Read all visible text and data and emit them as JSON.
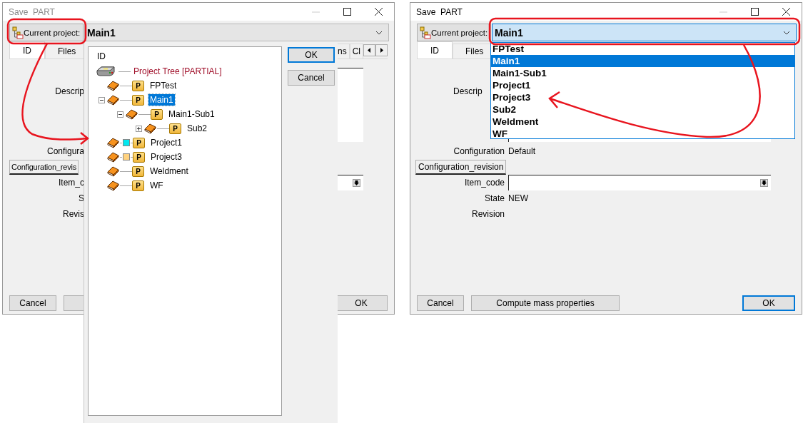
{
  "left_dialog": {
    "title": "Save  PART",
    "active": false,
    "project_label": "Current project:",
    "project": "Main1",
    "project_focused": false,
    "tabs": [
      {
        "label": "ID",
        "selected": true
      },
      {
        "label": "Files",
        "selected": false
      }
    ],
    "tabs_tail": [
      {
        "label": "ns",
        "selected": false
      },
      {
        "label": "Cl",
        "selected": false
      }
    ],
    "fields": [
      {
        "kind": "multiline",
        "label": "Descrip"
      },
      {
        "kind": "text",
        "label": "Configura"
      },
      {
        "kind": "button",
        "label": "Configuration_revis"
      },
      {
        "kind": "dropdown",
        "label": "Item_c"
      },
      {
        "kind": "text",
        "label": "S"
      },
      {
        "kind": "text",
        "label": "Revis"
      }
    ],
    "buttons": [
      {
        "kind": "cancel",
        "label": "Cancel",
        "focused": false
      },
      {
        "kind": "blank",
        "focused": false
      },
      {
        "kind": "ok",
        "label": "OK",
        "focused": false
      }
    ],
    "popup": {
      "header": "ID",
      "tree": {
        "label": "Project Tree [PARTIAL]",
        "children": [
          {
            "label": "FPTest",
            "icon_letter": "P",
            "selected": false
          },
          {
            "label": "Main1",
            "icon_letter": "P",
            "selected": true,
            "expanded": true,
            "children": [
              {
                "label": "Main1-Sub1",
                "icon_letter": "P",
                "selected": false,
                "expanded": true,
                "children": [
                  {
                    "label": "Sub2",
                    "icon_letter": "P",
                    "selected": false,
                    "expanded": false
                  }
                ]
              }
            ]
          },
          {
            "label": "Project1",
            "icon_letter": "P",
            "selected": false,
            "color": "#00e8f0"
          },
          {
            "label": "Project3",
            "icon_letter": "P",
            "selected": false,
            "color": "#ffd27f"
          },
          {
            "label": "Weldment",
            "icon_letter": "P",
            "selected": false
          },
          {
            "label": "WF",
            "icon_letter": "P",
            "selected": false
          }
        ]
      },
      "buttons": [
        {
          "label": "OK",
          "focused": true
        },
        {
          "label": "Cancel",
          "focused": false
        }
      ]
    }
  },
  "right_dialog": {
    "title": "Save  PART",
    "active": true,
    "project_label": "Current project:",
    "project": "Main1",
    "project_focused": true,
    "tabs": [
      {
        "label": "ID",
        "selected": true
      },
      {
        "label": "Files",
        "selected": false
      }
    ],
    "fields": [
      {
        "kind": "multiline",
        "label": "Descrip"
      },
      {
        "kind": "text",
        "label": "Configuration",
        "value": "Default"
      },
      {
        "kind": "button",
        "label": "Configuration_revision"
      },
      {
        "kind": "dropdown",
        "label": "Item_code"
      },
      {
        "kind": "text",
        "label": "State",
        "value": "NEW"
      },
      {
        "kind": "text",
        "label": "Revision"
      }
    ],
    "buttons": [
      {
        "kind": "cancel",
        "label": "Cancel",
        "focused": false
      },
      {
        "kind": "compute",
        "label": "Compute mass properties",
        "focused": false
      },
      {
        "kind": "ok",
        "label": "OK",
        "focused": true
      }
    ],
    "dropdown": [
      {
        "label": "FPTest",
        "selected": false
      },
      {
        "label": "Main1",
        "selected": true
      },
      {
        "label": "Main1-Sub1",
        "selected": false
      },
      {
        "label": "Project1",
        "selected": false
      },
      {
        "label": "Project3",
        "selected": false
      },
      {
        "label": "Sub2",
        "selected": false
      },
      {
        "label": "Weldment",
        "selected": false
      },
      {
        "label": "WF",
        "selected": false
      }
    ]
  }
}
